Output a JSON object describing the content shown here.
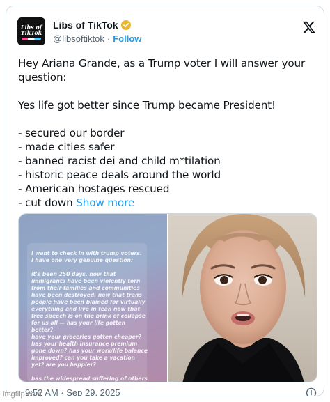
{
  "account": {
    "avatar_text": "Libs of TikTok",
    "display_name": "Libs of TikTok",
    "handle": "@libsoftiktok",
    "separator": "·",
    "follow_label": "Follow"
  },
  "tweet": {
    "text": "Hey Ariana Grande, as a Trump voter I will answer your\nquestion:\n\nYes life got better since Trump became President!\n\n- secured our border\n- made cities safer\n- banned racist dei and child m*tilation\n- historic peace deals around the world\n- American hostages rescued\n- cut down ",
    "show_more_label": "Show more"
  },
  "media": {
    "left_image_text": "i want to check in with trump voters.\ni have one very genuine question:\n\nit's been 250 days. now that\nimmigrants have been violently torn\nfrom their families and communities\nhave been destroyed, now that trans\npeople have been blamed for virtually\neverything and live in fear, now that\nfree speech is on the brink of collapse\nfor us all — has your life gotten better?\nhave your groceries gotten cheaper?\nhas your health insurance premium\ngone down? has your work/life balance\nimproved? can you take a vacation\nyet? are you happier?\n\nhas the widespread suffering of others"
  },
  "footer": {
    "timestamp": "9:52 AM · Sep 29, 2025"
  },
  "watermark": "imgflip.com",
  "colors": {
    "link": "#1d9bf0",
    "text": "#0f1419",
    "muted": "#536471",
    "verified_badge": "#e8b730"
  },
  "icons": [
    "verified-badge-icon",
    "x-logo-icon",
    "info-icon"
  ]
}
